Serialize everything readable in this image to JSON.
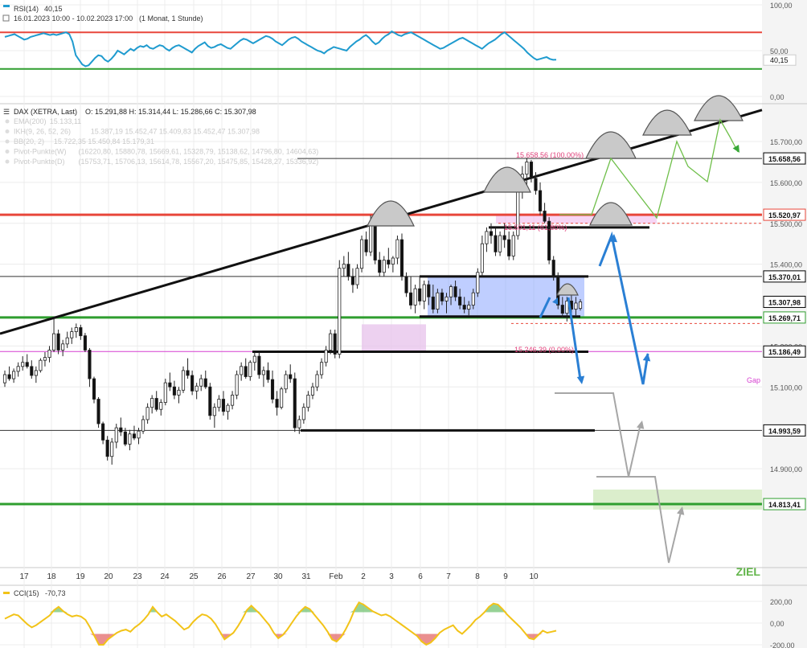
{
  "rsi_panel": {
    "title": "RSI(14)",
    "value": "40,15",
    "range": "16.01.2023 10:00 - 10.02.2023 17:00",
    "period": "(1 Monat, 1 Stunde)",
    "ticks": [
      "100,00",
      "50,00",
      "0,00"
    ],
    "current_label": "40,15"
  },
  "main_panel": {
    "instrument": "DAX (XETRA, Last)",
    "ohlc": "O: 15.291,88  H: 15.314,44  L: 15.286,66  C: 15.307,98",
    "indicators": [
      {
        "label": "EMA(200)",
        "values": "15.133,11"
      },
      {
        "label": "IKH(9, 26, 52, 26)",
        "values": "15.387,19  15.452,47  15.409,83  15.452,47  15.307,98"
      },
      {
        "label": "BB(20, 2)",
        "values": "15.722,35  15.450,84  15.179,31"
      },
      {
        "label": "Pivot-Punkte(W)",
        "values": "(16220,80,  15880,78,  15669,61,  15328,79,  15138,62,  14796,80,  14604,63)"
      },
      {
        "label": "Pivot-Punkte(D)",
        "values": "(15753,71,  15706,13,  15614,78,  15567,20,  15475,85,  15428,27,  15336,92)"
      }
    ],
    "price_ticks": [
      "15.700,00",
      "15.600,00",
      "15.500,00",
      "15.400,00",
      "15.200,00",
      "15.100,00",
      "14.900,00"
    ],
    "level_labels": [
      {
        "text": "15.658,56",
        "color": "#000000"
      },
      {
        "text": "15.520,97",
        "color": "#e8473b"
      },
      {
        "text": "15.370,01",
        "color": "#000000"
      },
      {
        "text": "15.307,98",
        "color": "#000000"
      },
      {
        "text": "15.269,71",
        "color": "#2f9e2f"
      },
      {
        "text": "15.186,49",
        "color": "#000000"
      },
      {
        "text": "14.993,59",
        "color": "#000000"
      },
      {
        "text": "14.813,41",
        "color": "#2f9e2f"
      }
    ],
    "annotations": {
      "fib_100": "15.658,56 (100,00%)",
      "fib_61": "15.501,11 (61,80%)",
      "fib_0": "15.246,39 (0,00%)",
      "gap": "Gap",
      "ziel": "ZIEL"
    },
    "x_labels": [
      "17",
      "18",
      "19",
      "20",
      "23",
      "24",
      "25",
      "26",
      "27",
      "30",
      "31",
      "Feb",
      "2",
      "3",
      "6",
      "7",
      "8",
      "9",
      "10"
    ]
  },
  "cci_panel": {
    "title": "CCI(15)",
    "value": "-70,73",
    "ticks": [
      "200,00",
      "0,00",
      "-200,00"
    ]
  },
  "colors": {
    "red_line": "#e8473b",
    "green_line": "#2f9e2f",
    "blue_arrow": "#2a7fd4",
    "rsi_line": "#1f9bcf",
    "cci_line": "#f2c318",
    "candle_up": "#ffffff",
    "candle_down": "#111111",
    "forecast_green": "#6fbf4a",
    "forecast_gray": "#a6a6a6"
  },
  "chart_data": [
    {
      "type": "line",
      "title": "RSI(14)",
      "ylim": [
        0,
        100
      ],
      "levels": [
        70,
        30
      ],
      "last": 40.15,
      "values": [
        65,
        66,
        67,
        68,
        66,
        64,
        62,
        63,
        65,
        66,
        67,
        68,
        69,
        68,
        67,
        68,
        67,
        68,
        69,
        70,
        68,
        60,
        45,
        40,
        35,
        33,
        34,
        38,
        42,
        45,
        44,
        40,
        38,
        41,
        45,
        50,
        48,
        46,
        49,
        52,
        50,
        53,
        55,
        54,
        56,
        53,
        52,
        54,
        56,
        55,
        52,
        50,
        53,
        55,
        56,
        54,
        52,
        50,
        48,
        52,
        55,
        57,
        59,
        55,
        53,
        54,
        56,
        57,
        55,
        53,
        52,
        55,
        58,
        61,
        63,
        62,
        60,
        58,
        60,
        62,
        64,
        66,
        65,
        63,
        60,
        58,
        56,
        59,
        62,
        64,
        65,
        63,
        60,
        58,
        56,
        54,
        52,
        50,
        49,
        47,
        50,
        52,
        54,
        53,
        52,
        51,
        50,
        54,
        57,
        60,
        62,
        65,
        67,
        64,
        60,
        57,
        59,
        63,
        66,
        68,
        71,
        69,
        67,
        66,
        68,
        69,
        70,
        68,
        66,
        64,
        62,
        60,
        58,
        56,
        54,
        52,
        53,
        55,
        57,
        59,
        61,
        63,
        64,
        62,
        60,
        58,
        56,
        54,
        52,
        55,
        58,
        60,
        62,
        65,
        68,
        70,
        67,
        64,
        61,
        58,
        55,
        52,
        48,
        45,
        42,
        40,
        41,
        42,
        43,
        41,
        40,
        40.15
      ]
    },
    {
      "type": "candlestick",
      "title": "DAX (XETRA, Last)",
      "ylim": [
        14800,
        15780
      ],
      "levels": [
        15658.56,
        15520.97,
        15370.01,
        15307.98,
        15269.71,
        15186.49,
        14993.59,
        14813.41
      ],
      "last": {
        "open": 15291.88,
        "high": 15314.44,
        "low": 15286.66,
        "close": 15307.98
      },
      "ohlc": [
        [
          15110,
          15140,
          15100,
          15130
        ],
        [
          15130,
          15150,
          15115,
          15120
        ],
        [
          15120,
          15145,
          15110,
          15138
        ],
        [
          15138,
          15160,
          15125,
          15150
        ],
        [
          15150,
          15175,
          15140,
          15160
        ],
        [
          15160,
          15180,
          15145,
          15150
        ],
        [
          15150,
          15165,
          15120,
          15128
        ],
        [
          15128,
          15150,
          15110,
          15140
        ],
        [
          15140,
          15170,
          15135,
          15165
        ],
        [
          15165,
          15185,
          15150,
          15172
        ],
        [
          15172,
          15200,
          15160,
          15190
        ],
        [
          15190,
          15270,
          15185,
          15230
        ],
        [
          15230,
          15240,
          15180,
          15190
        ],
        [
          15190,
          15215,
          15175,
          15205
        ],
        [
          15205,
          15235,
          15195,
          15220
        ],
        [
          15220,
          15245,
          15205,
          15235
        ],
        [
          15235,
          15255,
          15220,
          15245
        ],
        [
          15245,
          15252,
          15215,
          15225
        ],
        [
          15225,
          15232,
          15185,
          15190
        ],
        [
          15190,
          15195,
          15100,
          15120
        ],
        [
          15120,
          15125,
          15060,
          15070
        ],
        [
          15070,
          15075,
          15000,
          15010
        ],
        [
          15010,
          15015,
          14960,
          14970
        ],
        [
          14970,
          14980,
          14920,
          14930
        ],
        [
          14930,
          14975,
          14910,
          14965
        ],
        [
          14965,
          15010,
          14950,
          15000
        ],
        [
          15000,
          15025,
          14980,
          14990
        ],
        [
          14990,
          15000,
          14955,
          14960
        ],
        [
          14960,
          14995,
          14945,
          14985
        ],
        [
          14985,
          15005,
          14970,
          14975
        ],
        [
          14975,
          15000,
          14960,
          14992
        ],
        [
          14992,
          15030,
          14985,
          15020
        ],
        [
          15020,
          15060,
          15010,
          15050
        ],
        [
          15050,
          15080,
          15035,
          15072
        ],
        [
          15072,
          15090,
          15040,
          15045
        ],
        [
          15045,
          15070,
          15030,
          15062
        ],
        [
          15062,
          15120,
          15055,
          15110
        ],
        [
          15110,
          15135,
          15090,
          15100
        ],
        [
          15100,
          15115,
          15070,
          15080
        ],
        [
          15080,
          15100,
          15060,
          15092
        ],
        [
          15092,
          15150,
          15085,
          15140
        ],
        [
          15140,
          15170,
          15120,
          15128
        ],
        [
          15128,
          15140,
          15080,
          15090
        ],
        [
          15090,
          15110,
          15070,
          15102
        ],
        [
          15102,
          15130,
          15090,
          15120
        ],
        [
          15120,
          15140,
          15095,
          15100
        ],
        [
          15100,
          15110,
          15020,
          15030
        ],
        [
          15030,
          15060,
          15000,
          15050
        ],
        [
          15050,
          15080,
          15040,
          15070
        ],
        [
          15070,
          15090,
          15030,
          15040
        ],
        [
          15040,
          15060,
          15020,
          15055
        ],
        [
          15055,
          15090,
          15045,
          15080
        ],
        [
          15080,
          15140,
          15070,
          15130
        ],
        [
          15130,
          15160,
          15115,
          15150
        ],
        [
          15150,
          15170,
          15120,
          15125
        ],
        [
          15125,
          15165,
          15115,
          15160
        ],
        [
          15160,
          15185,
          15140,
          15175
        ],
        [
          15175,
          15185,
          15120,
          15130
        ],
        [
          15130,
          15150,
          15100,
          15140
        ],
        [
          15140,
          15160,
          15110,
          15118
        ],
        [
          15118,
          15140,
          15060,
          15070
        ],
        [
          15070,
          15090,
          15030,
          15050
        ],
        [
          15050,
          15100,
          15045,
          15095
        ],
        [
          15095,
          15140,
          15085,
          15130
        ],
        [
          15130,
          15155,
          15110,
          15120
        ],
        [
          15120,
          15135,
          14990,
          15000
        ],
        [
          15000,
          15030,
          14985,
          15020
        ],
        [
          15020,
          15060,
          15010,
          15050
        ],
        [
          15050,
          15090,
          15040,
          15080
        ],
        [
          15080,
          15110,
          15070,
          15100
        ],
        [
          15100,
          15140,
          15090,
          15130
        ],
        [
          15130,
          15170,
          15120,
          15160
        ],
        [
          15160,
          15200,
          15150,
          15190
        ],
        [
          15190,
          15240,
          15180,
          15230
        ],
        [
          15230,
          15240,
          15170,
          15180
        ],
        [
          15180,
          15410,
          15170,
          15390
        ],
        [
          15390,
          15420,
          15370,
          15400
        ],
        [
          15400,
          15430,
          15360,
          15370
        ],
        [
          15370,
          15390,
          15330,
          15350
        ],
        [
          15350,
          15400,
          15340,
          15390
        ],
        [
          15390,
          15470,
          15380,
          15460
        ],
        [
          15460,
          15480,
          15420,
          15430
        ],
        [
          15430,
          15520,
          15420,
          15500
        ],
        [
          15500,
          15510,
          15400,
          15410
        ],
        [
          15410,
          15430,
          15370,
          15380
        ],
        [
          15380,
          15420,
          15370,
          15410
        ],
        [
          15410,
          15440,
          15390,
          15400
        ],
        [
          15400,
          15420,
          15380,
          15415
        ],
        [
          15415,
          15470,
          15400,
          15460
        ],
        [
          15460,
          15475,
          15360,
          15370
        ],
        [
          15370,
          15380,
          15320,
          15330
        ],
        [
          15330,
          15370,
          15290,
          15300
        ],
        [
          15300,
          15350,
          15280,
          15340
        ],
        [
          15340,
          15370,
          15300,
          15310
        ],
        [
          15310,
          15360,
          15290,
          15350
        ],
        [
          15350,
          15360,
          15300,
          15320
        ],
        [
          15320,
          15350,
          15280,
          15290
        ],
        [
          15290,
          15340,
          15280,
          15330
        ],
        [
          15330,
          15340,
          15300,
          15310
        ],
        [
          15310,
          15330,
          15280,
          15320
        ],
        [
          15320,
          15350,
          15300,
          15345
        ],
        [
          15345,
          15360,
          15310,
          15320
        ],
        [
          15320,
          15340,
          15290,
          15300
        ],
        [
          15300,
          15320,
          15280,
          15290
        ],
        [
          15290,
          15310,
          15275,
          15300
        ],
        [
          15300,
          15340,
          15290,
          15330
        ],
        [
          15330,
          15390,
          15320,
          15380
        ],
        [
          15380,
          15470,
          15370,
          15450
        ],
        [
          15450,
          15490,
          15430,
          15480
        ],
        [
          15480,
          15500,
          15450,
          15470
        ],
        [
          15470,
          15490,
          15420,
          15430
        ],
        [
          15430,
          15480,
          15420,
          15470
        ],
        [
          15470,
          15500,
          15440,
          15460
        ],
        [
          15460,
          15480,
          15410,
          15420
        ],
        [
          15420,
          15480,
          15410,
          15470
        ],
        [
          15470,
          15600,
          15460,
          15580
        ],
        [
          15580,
          15640,
          15560,
          15620
        ],
        [
          15620,
          15660,
          15590,
          15650
        ],
        [
          15650,
          15655,
          15600,
          15610
        ],
        [
          15610,
          15625,
          15570,
          15580
        ],
        [
          15580,
          15600,
          15520,
          15530
        ],
        [
          15530,
          15550,
          15500,
          15505
        ],
        [
          15505,
          15515,
          15400,
          15410
        ],
        [
          15410,
          15420,
          15360,
          15370
        ],
        [
          15370,
          15380,
          15290,
          15300
        ],
        [
          15300,
          15320,
          15270,
          15280
        ],
        [
          15280,
          15320,
          15260,
          15310
        ],
        [
          15310,
          15330,
          15280,
          15290
        ],
        [
          15290,
          15320,
          15275,
          15305
        ],
        [
          15291.88,
          15314.44,
          15286.66,
          15307.98
        ]
      ]
    },
    {
      "type": "area",
      "title": "CCI(15)",
      "ylim": [
        -220,
        260
      ],
      "last": -70.73,
      "values": [
        40,
        60,
        80,
        70,
        30,
        -10,
        -40,
        -20,
        10,
        40,
        70,
        120,
        150,
        110,
        80,
        60,
        70,
        60,
        30,
        -40,
        -120,
        -200,
        -200,
        -150,
        -120,
        -90,
        -70,
        -60,
        -80,
        -40,
        -10,
        30,
        80,
        150,
        100,
        60,
        80,
        50,
        20,
        -20,
        -60,
        -40,
        10,
        50,
        80,
        70,
        40,
        -10,
        -80,
        -150,
        -120,
        -90,
        -30,
        40,
        120,
        160,
        120,
        80,
        30,
        -20,
        -90,
        -140,
        -110,
        -60,
        0,
        60,
        110,
        150,
        130,
        80,
        30,
        -20,
        -80,
        -150,
        -170,
        -130,
        -60,
        20,
        120,
        190,
        170,
        140,
        110,
        90,
        70,
        80,
        60,
        30,
        0,
        -30,
        -60,
        -90,
        -120,
        -170,
        -200,
        -180,
        -140,
        -90,
        -60,
        -40,
        -20,
        -70,
        -100,
        -60,
        -20,
        30,
        60,
        100,
        150,
        180,
        170,
        130,
        80,
        40,
        0,
        -40,
        -90,
        -140,
        -150,
        -110,
        -70,
        -90,
        -80,
        -70.73
      ]
    }
  ]
}
